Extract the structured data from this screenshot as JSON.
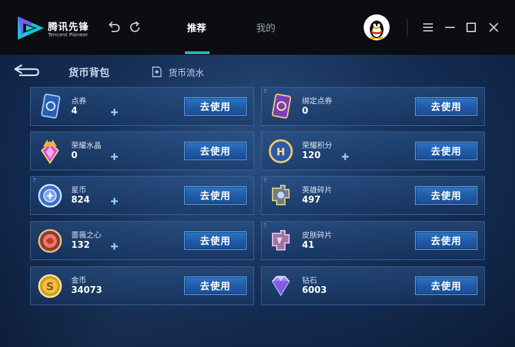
{
  "app": {
    "logo_cn": "腾讯先锋",
    "logo_en": "Tencent Pioneer"
  },
  "tabs": [
    {
      "label": "推荐",
      "active": true
    },
    {
      "label": "我的",
      "active": false
    }
  ],
  "page": {
    "title": "货币背包",
    "flow_link": "货币流水"
  },
  "colors": {
    "accent": "#1fb9c9",
    "button": "#2d75c6",
    "background": "#163058"
  },
  "currencies": [
    {
      "name": "点券",
      "value": "4",
      "icon": "voucher-icon",
      "has_plus": true,
      "has_help": false,
      "button": "去使用"
    },
    {
      "name": "绑定点券",
      "value": "0",
      "icon": "bound-voucher-icon",
      "has_plus": false,
      "has_help": true,
      "button": "去使用"
    },
    {
      "name": "荣耀水晶",
      "value": "0",
      "icon": "glory-crystal-icon",
      "has_plus": true,
      "has_help": false,
      "button": "去使用"
    },
    {
      "name": "荣耀积分",
      "value": "120",
      "icon": "glory-points-icon",
      "has_plus": true,
      "has_help": false,
      "button": "去使用"
    },
    {
      "name": "星币",
      "value": "824",
      "icon": "star-coin-icon",
      "has_plus": true,
      "has_help": true,
      "button": "去使用"
    },
    {
      "name": "英雄碎片",
      "value": "497",
      "icon": "hero-fragment-icon",
      "has_plus": false,
      "has_help": true,
      "button": "去使用"
    },
    {
      "name": "蔷薇之心",
      "value": "132",
      "icon": "rose-heart-icon",
      "has_plus": true,
      "has_help": false,
      "button": "去使用"
    },
    {
      "name": "皮肤碎片",
      "value": "41",
      "icon": "skin-fragment-icon",
      "has_plus": false,
      "has_help": true,
      "button": "去使用"
    },
    {
      "name": "金币",
      "value": "34073",
      "icon": "gold-coin-icon",
      "has_plus": false,
      "has_help": false,
      "button": "去使用"
    },
    {
      "name": "钻石",
      "value": "6003",
      "icon": "diamond-icon",
      "has_plus": false,
      "has_help": false,
      "button": "去使用"
    }
  ]
}
